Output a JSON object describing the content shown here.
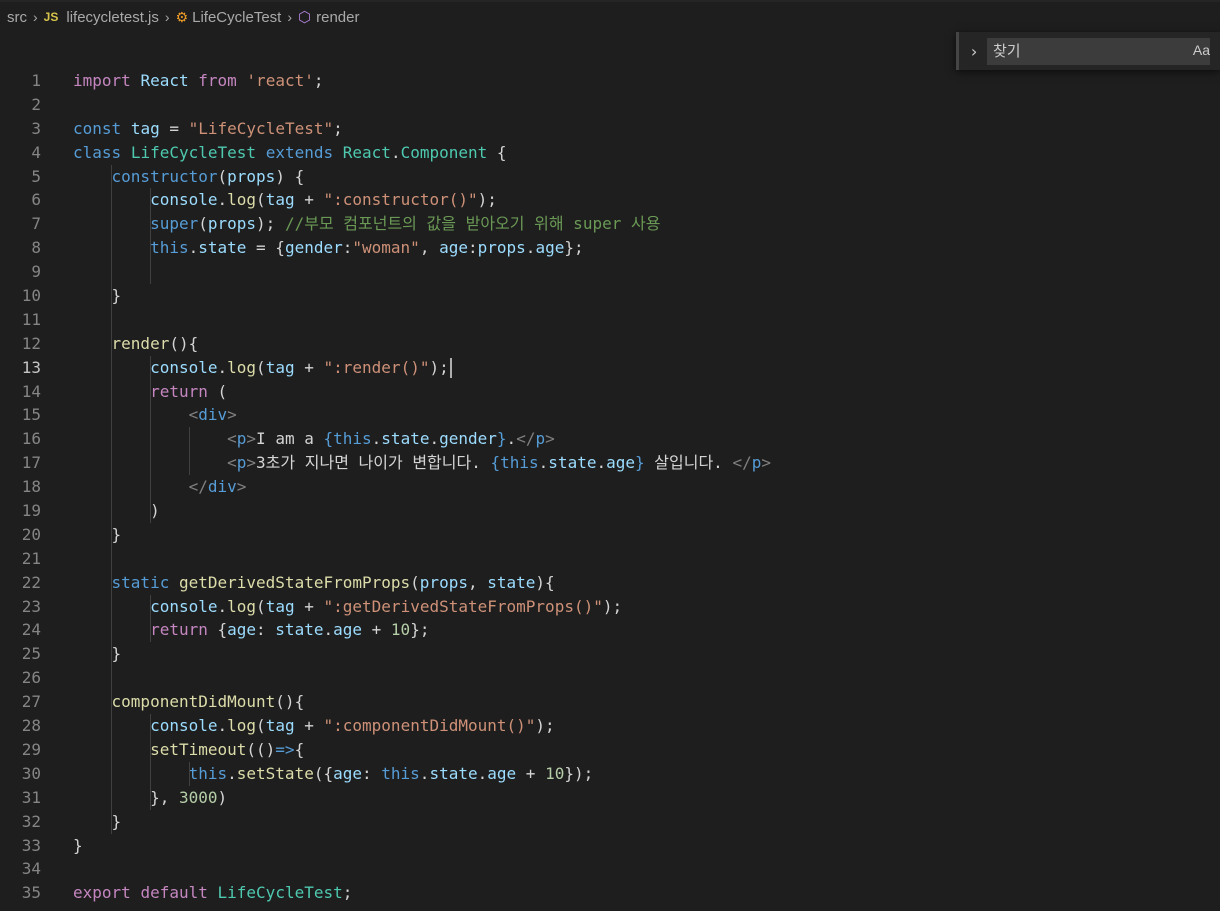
{
  "breadcrumb": {
    "items": [
      {
        "label": "src"
      },
      {
        "icon": "JS",
        "label": "lifecycletest.js"
      },
      {
        "label": "LifeCycleTest"
      },
      {
        "label": "render"
      }
    ]
  },
  "find": {
    "placeholder": "찾기",
    "case_toggle": "Aa"
  },
  "editor": {
    "current_line": 13,
    "lines": [
      {
        "n": "1",
        "t": [
          [
            "ctl",
            "import"
          ],
          [
            "txt",
            " "
          ],
          [
            "var",
            "React"
          ],
          [
            "txt",
            " "
          ],
          [
            "ctl",
            "from"
          ],
          [
            "txt",
            " "
          ],
          [
            "str",
            "'react'"
          ],
          [
            "txt",
            ";"
          ]
        ]
      },
      {
        "n": "2",
        "t": []
      },
      {
        "n": "3",
        "t": [
          [
            "kw",
            "const"
          ],
          [
            "txt",
            " "
          ],
          [
            "var",
            "tag"
          ],
          [
            "txt",
            " = "
          ],
          [
            "str",
            "\"LifeCycleTest\""
          ],
          [
            "txt",
            ";"
          ]
        ]
      },
      {
        "n": "4",
        "t": [
          [
            "kw",
            "class"
          ],
          [
            "txt",
            " "
          ],
          [
            "cls",
            "LifeCycleTest"
          ],
          [
            "txt",
            " "
          ],
          [
            "kw",
            "extends"
          ],
          [
            "txt",
            " "
          ],
          [
            "cls",
            "React"
          ],
          [
            "txt",
            "."
          ],
          [
            "cls",
            "Component"
          ],
          [
            "txt",
            " {"
          ]
        ]
      },
      {
        "n": "5",
        "t": [
          [
            "txt",
            "    "
          ],
          [
            "kw",
            "constructor"
          ],
          [
            "txt",
            "("
          ],
          [
            "var",
            "props"
          ],
          [
            "txt",
            ") {"
          ]
        ]
      },
      {
        "n": "6",
        "t": [
          [
            "txt",
            "        "
          ],
          [
            "var",
            "console"
          ],
          [
            "txt",
            "."
          ],
          [
            "fn",
            "log"
          ],
          [
            "txt",
            "("
          ],
          [
            "var",
            "tag"
          ],
          [
            "txt",
            " + "
          ],
          [
            "str",
            "\":constructor()\""
          ],
          [
            "txt",
            ");"
          ]
        ]
      },
      {
        "n": "7",
        "t": [
          [
            "txt",
            "        "
          ],
          [
            "kw",
            "super"
          ],
          [
            "txt",
            "("
          ],
          [
            "var",
            "props"
          ],
          [
            "txt",
            "); "
          ],
          [
            "cmt",
            "//부모 컴포넌트의 값을 받아오기 위해 super 사용"
          ]
        ]
      },
      {
        "n": "8",
        "t": [
          [
            "txt",
            "        "
          ],
          [
            "kw",
            "this"
          ],
          [
            "txt",
            "."
          ],
          [
            "var",
            "state"
          ],
          [
            "txt",
            " = {"
          ],
          [
            "var",
            "gender"
          ],
          [
            "txt",
            ":"
          ],
          [
            "str",
            "\"woman\""
          ],
          [
            "txt",
            ", "
          ],
          [
            "var",
            "age"
          ],
          [
            "txt",
            ":"
          ],
          [
            "var",
            "props"
          ],
          [
            "txt",
            "."
          ],
          [
            "var",
            "age"
          ],
          [
            "txt",
            "};"
          ]
        ]
      },
      {
        "n": "9",
        "t": []
      },
      {
        "n": "10",
        "t": [
          [
            "txt",
            "    }"
          ]
        ]
      },
      {
        "n": "11",
        "t": []
      },
      {
        "n": "12",
        "t": [
          [
            "txt",
            "    "
          ],
          [
            "fn",
            "render"
          ],
          [
            "txt",
            "()"
          ],
          [
            "txt",
            "{"
          ]
        ]
      },
      {
        "n": "13",
        "t": [
          [
            "txt",
            "        "
          ],
          [
            "var",
            "console"
          ],
          [
            "txt",
            "."
          ],
          [
            "fn",
            "log"
          ],
          [
            "txt",
            "("
          ],
          [
            "var",
            "tag"
          ],
          [
            "txt",
            " + "
          ],
          [
            "str",
            "\":render()\""
          ],
          [
            "txt",
            ");"
          ]
        ]
      },
      {
        "n": "14",
        "t": [
          [
            "txt",
            "        "
          ],
          [
            "ctl",
            "return"
          ],
          [
            "txt",
            " ("
          ]
        ]
      },
      {
        "n": "15",
        "t": [
          [
            "txt",
            "            "
          ],
          [
            "punc",
            "<"
          ],
          [
            "tag",
            "div"
          ],
          [
            "punc",
            ">"
          ]
        ]
      },
      {
        "n": "16",
        "t": [
          [
            "txt",
            "                "
          ],
          [
            "punc",
            "<"
          ],
          [
            "tag",
            "p"
          ],
          [
            "punc",
            ">"
          ],
          [
            "txt",
            "I am a "
          ],
          [
            "kw",
            "{"
          ],
          [
            "kw",
            "this"
          ],
          [
            "txt",
            "."
          ],
          [
            "var",
            "state"
          ],
          [
            "txt",
            "."
          ],
          [
            "var",
            "gender"
          ],
          [
            "kw",
            "}"
          ],
          [
            "txt",
            "."
          ],
          [
            "punc",
            "</"
          ],
          [
            "tag",
            "p"
          ],
          [
            "punc",
            ">"
          ]
        ]
      },
      {
        "n": "17",
        "t": [
          [
            "txt",
            "                "
          ],
          [
            "punc",
            "<"
          ],
          [
            "tag",
            "p"
          ],
          [
            "punc",
            ">"
          ],
          [
            "txt",
            "3초가 지나면 나이가 변합니다. "
          ],
          [
            "kw",
            "{"
          ],
          [
            "kw",
            "this"
          ],
          [
            "txt",
            "."
          ],
          [
            "var",
            "state"
          ],
          [
            "txt",
            "."
          ],
          [
            "var",
            "age"
          ],
          [
            "kw",
            "}"
          ],
          [
            "txt",
            " 살입니다. "
          ],
          [
            "punc",
            "</"
          ],
          [
            "tag",
            "p"
          ],
          [
            "punc",
            ">"
          ]
        ]
      },
      {
        "n": "18",
        "t": [
          [
            "txt",
            "            "
          ],
          [
            "punc",
            "</"
          ],
          [
            "tag",
            "div"
          ],
          [
            "punc",
            ">"
          ]
        ]
      },
      {
        "n": "19",
        "t": [
          [
            "txt",
            "        )"
          ]
        ]
      },
      {
        "n": "20",
        "t": [
          [
            "txt",
            "    "
          ],
          [
            "txt",
            "}"
          ]
        ]
      },
      {
        "n": "21",
        "t": []
      },
      {
        "n": "22",
        "t": [
          [
            "txt",
            "    "
          ],
          [
            "kw",
            "static"
          ],
          [
            "txt",
            " "
          ],
          [
            "fn",
            "getDerivedStateFromProps"
          ],
          [
            "txt",
            "("
          ],
          [
            "var",
            "props"
          ],
          [
            "txt",
            ", "
          ],
          [
            "var",
            "state"
          ],
          [
            "txt",
            "){"
          ]
        ]
      },
      {
        "n": "23",
        "t": [
          [
            "txt",
            "        "
          ],
          [
            "var",
            "console"
          ],
          [
            "txt",
            "."
          ],
          [
            "fn",
            "log"
          ],
          [
            "txt",
            "("
          ],
          [
            "var",
            "tag"
          ],
          [
            "txt",
            " + "
          ],
          [
            "str",
            "\":getDerivedStateFromProps()\""
          ],
          [
            "txt",
            ");"
          ]
        ]
      },
      {
        "n": "24",
        "t": [
          [
            "txt",
            "        "
          ],
          [
            "ctl",
            "return"
          ],
          [
            "txt",
            " {"
          ],
          [
            "var",
            "age"
          ],
          [
            "txt",
            ": "
          ],
          [
            "var",
            "state"
          ],
          [
            "txt",
            "."
          ],
          [
            "var",
            "age"
          ],
          [
            "txt",
            " + "
          ],
          [
            "num",
            "10"
          ],
          [
            "txt",
            "};"
          ]
        ]
      },
      {
        "n": "25",
        "t": [
          [
            "txt",
            "    }"
          ]
        ]
      },
      {
        "n": "26",
        "t": []
      },
      {
        "n": "27",
        "t": [
          [
            "txt",
            "    "
          ],
          [
            "fn",
            "componentDidMount"
          ],
          [
            "txt",
            "(){"
          ]
        ]
      },
      {
        "n": "28",
        "t": [
          [
            "txt",
            "        "
          ],
          [
            "var",
            "console"
          ],
          [
            "txt",
            "."
          ],
          [
            "fn",
            "log"
          ],
          [
            "txt",
            "("
          ],
          [
            "var",
            "tag"
          ],
          [
            "txt",
            " + "
          ],
          [
            "str",
            "\":componentDidMount()\""
          ],
          [
            "txt",
            ");"
          ]
        ]
      },
      {
        "n": "29",
        "t": [
          [
            "txt",
            "        "
          ],
          [
            "fn",
            "setTimeout"
          ],
          [
            "txt",
            "(()"
          ],
          [
            "kw",
            "=>"
          ],
          [
            "txt",
            "{"
          ]
        ]
      },
      {
        "n": "30",
        "t": [
          [
            "txt",
            "            "
          ],
          [
            "kw",
            "this"
          ],
          [
            "txt",
            "."
          ],
          [
            "fn",
            "setState"
          ],
          [
            "txt",
            "({"
          ],
          [
            "var",
            "age"
          ],
          [
            "txt",
            ": "
          ],
          [
            "kw",
            "this"
          ],
          [
            "txt",
            "."
          ],
          [
            "var",
            "state"
          ],
          [
            "txt",
            "."
          ],
          [
            "var",
            "age"
          ],
          [
            "txt",
            " + "
          ],
          [
            "num",
            "10"
          ],
          [
            "txt",
            "});"
          ]
        ]
      },
      {
        "n": "31",
        "t": [
          [
            "txt",
            "        }, "
          ],
          [
            "num",
            "3000"
          ],
          [
            "txt",
            ")"
          ]
        ]
      },
      {
        "n": "32",
        "t": [
          [
            "txt",
            "    }"
          ]
        ]
      },
      {
        "n": "33",
        "t": [
          [
            "txt",
            "}"
          ]
        ]
      },
      {
        "n": "34",
        "t": []
      },
      {
        "n": "35",
        "t": [
          [
            "ctl",
            "export"
          ],
          [
            "txt",
            " "
          ],
          [
            "ctl",
            "default"
          ],
          [
            "txt",
            " "
          ],
          [
            "cls",
            "LifeCycleTest"
          ],
          [
            "txt",
            ";"
          ]
        ]
      }
    ]
  }
}
